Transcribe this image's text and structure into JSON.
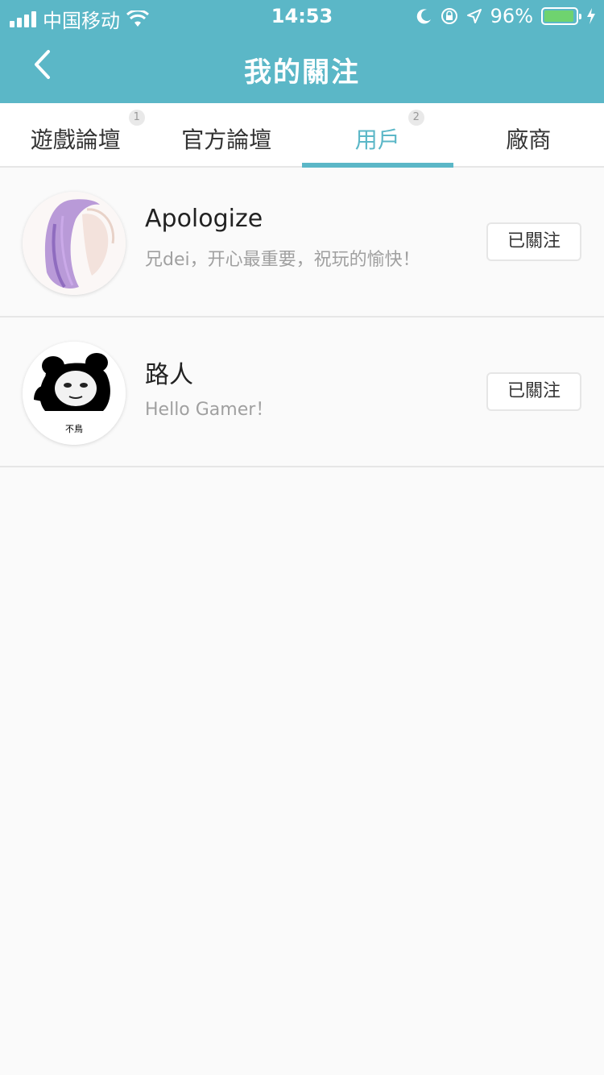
{
  "status_bar": {
    "carrier": "中国移动",
    "time": "14:53",
    "battery": "96%",
    "battery_level": 0.96,
    "icons": [
      "signal-icon",
      "wifi-icon",
      "moon-icon",
      "lock-rotation-icon",
      "location-icon",
      "battery-icon",
      "charging-icon"
    ]
  },
  "nav": {
    "title": "我的關注",
    "back_icon": "chevron-left-icon"
  },
  "tabs": [
    {
      "label": "遊戲論壇",
      "badge": "1",
      "active": false
    },
    {
      "label": "官方論壇",
      "badge": "",
      "active": false
    },
    {
      "label": "用戶",
      "badge": "2",
      "active": true
    },
    {
      "label": "廠商",
      "badge": "",
      "active": false
    }
  ],
  "users": [
    {
      "name": "Apologize",
      "desc": "兄dei，开心最重要，祝玩的愉快！",
      "button": "已關注"
    },
    {
      "name": "路人",
      "desc": "Hello Gamer！",
      "button": "已關注",
      "avatar_caption": "不鳥"
    }
  ],
  "colors": {
    "accent": "#5bb7c7",
    "text_primary": "#222222",
    "text_secondary": "#a0a0a0",
    "divider": "#e6e6e6"
  }
}
